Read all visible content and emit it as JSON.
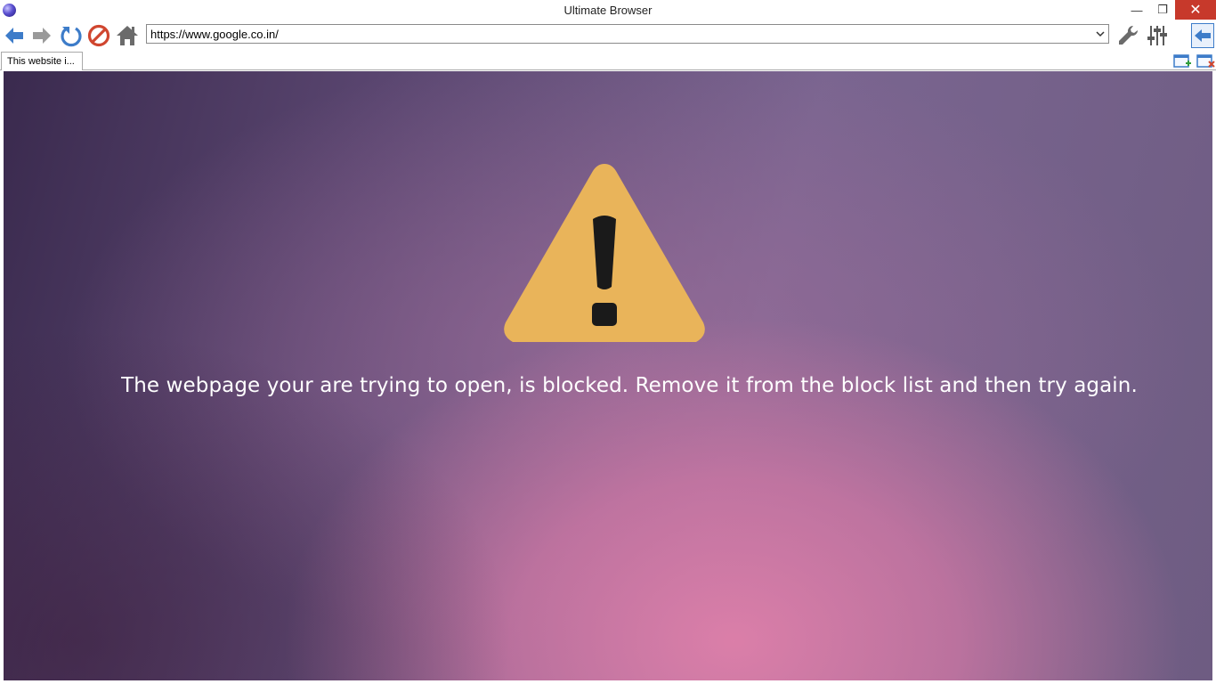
{
  "window": {
    "title": "Ultimate Browser",
    "minimize_glyph": "—",
    "maximize_glyph": "❐",
    "close_glyph": "✕"
  },
  "toolbar": {
    "back_icon": "arrow-left-icon",
    "forward_icon": "arrow-right-icon",
    "reload_icon": "reload-icon",
    "stop_icon": "stop-icon",
    "home_icon": "home-icon",
    "settings_icon": "wrench-icon",
    "adjust_icon": "sliders-icon",
    "panel_icon": "collapse-arrow-icon"
  },
  "address_bar": {
    "value": "https://www.google.co.in/"
  },
  "tabs": [
    {
      "label": "This website i..."
    }
  ],
  "tab_actions": {
    "new_tab_icon": "new-tab-icon",
    "close_tab_icon": "close-tab-icon"
  },
  "page": {
    "message": "The webpage your are trying to open, is blocked. Remove it from the block list and then try again."
  },
  "colors": {
    "warning_triangle": "#E9B45A",
    "exclamation": "#1a1a1a",
    "stop": "#d0462f",
    "nav_blue": "#3d7cc9",
    "home_gray": "#6b6b6b"
  }
}
